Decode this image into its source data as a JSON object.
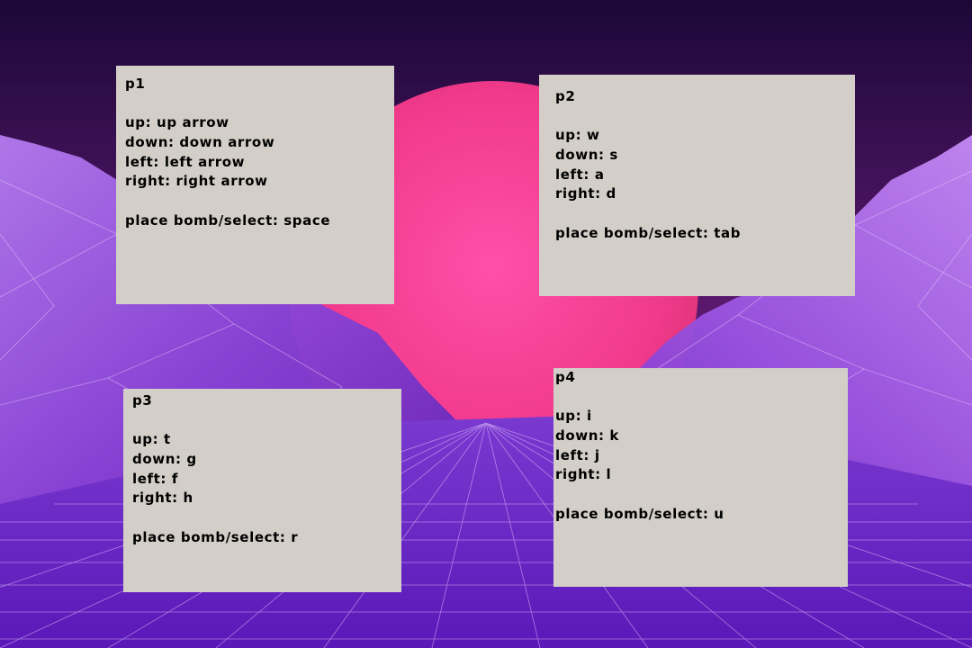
{
  "panels": [
    {
      "id": "p1",
      "title": "p1",
      "up": "up: up arrow",
      "down": "down: down arrow",
      "left": "left: left arrow",
      "right": "right: right arrow",
      "action": "place bomb/select: space"
    },
    {
      "id": "p2",
      "title": "p2",
      "up": "up: w",
      "down": "down: s",
      "left": "left: a",
      "right": "right: d",
      "action": "place bomb/select: tab"
    },
    {
      "id": "p3",
      "title": "p3",
      "up": "up: t",
      "down": "down: g",
      "left": "left: f",
      "right": "right: h",
      "action": "place bomb/select: r"
    },
    {
      "id": "p4",
      "title": "p4",
      "up": "up: i",
      "down": "down: k",
      "left": "left: j",
      "right": "right: l",
      "action": "place bomb/select: u"
    }
  ],
  "colors": {
    "panel_bg": "#d3cfc8",
    "sun": "#f03a8c",
    "sky_top": "#1a0833",
    "mountain": "#9a4fe0",
    "grid_floor": "#6a25c4"
  }
}
